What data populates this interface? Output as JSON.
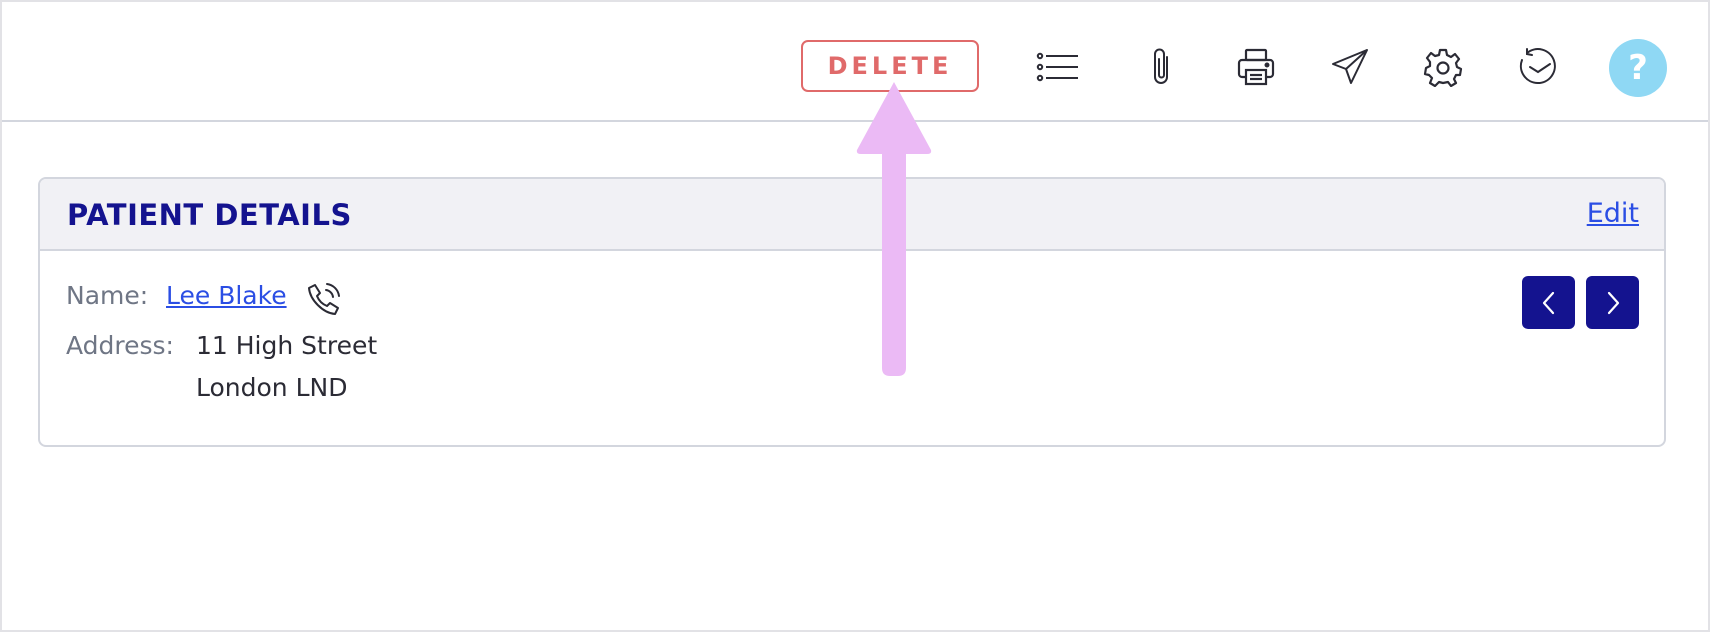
{
  "toolbar": {
    "delete_label": "DELETE",
    "icons": [
      "list-icon",
      "paperclip-icon",
      "printer-icon",
      "send-icon",
      "gear-icon",
      "history-icon"
    ],
    "help_label": "?"
  },
  "panel": {
    "title": "PATIENT DETAILS",
    "edit_label": "Edit",
    "name_label": "Name:",
    "name_value": "Lee Blake",
    "address_label": "Address:",
    "address_line1": "11 High Street",
    "address_line2": "London LND"
  },
  "colors": {
    "delete": "#e06a6a",
    "brand_navy": "#14138f",
    "link": "#2b4ee4",
    "help_bg": "#8fd8f4",
    "annotation": "#ebbaf5"
  }
}
